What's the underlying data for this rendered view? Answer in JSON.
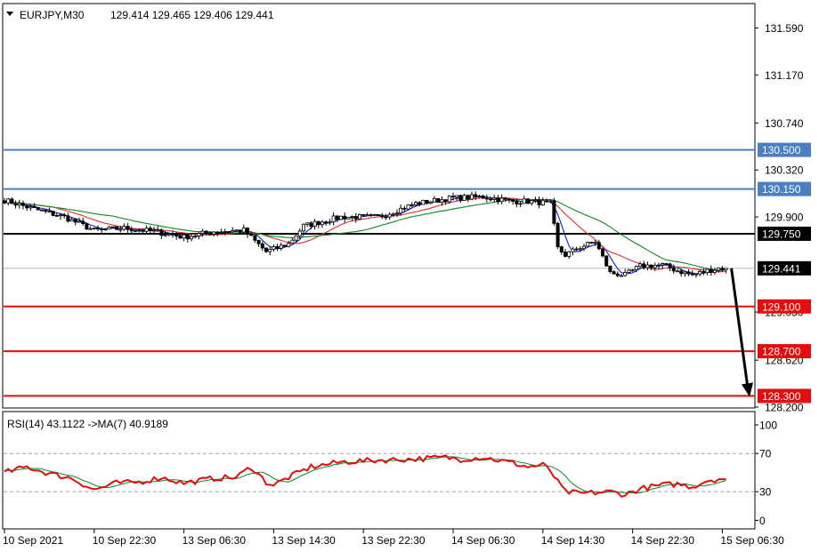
{
  "header": {
    "symbol_label": "EURJPY,M30",
    "ohlc": "129.414 129.465 129.406 129.441"
  },
  "rsi_header": "RSI(14) 43.1122  ->MA(7) 40.9189",
  "colors": {
    "background": "#ffffff",
    "frame": "#000000",
    "resistance": "#4a7fc1",
    "pivot": "#000000",
    "support": "#e30d0d",
    "candle": "#000000",
    "ma_fast": "#0c1bd6",
    "ma_mid": "#e03030",
    "ma_slow": "#0b8a22",
    "rsi": "#e30d0d",
    "rsi_ma": "#0b8a22",
    "current_price_line": "#b4b4b4",
    "arrow": "#000000"
  },
  "chart_data": [
    {
      "type": "candlestick",
      "symbol": "EURJPY",
      "timeframe": "M30",
      "ylim": [
        128.2,
        131.8
      ],
      "y_ticks": [
        "131.590",
        "131.170",
        "130.740",
        "130.320",
        "129.900",
        "129.050",
        "128.620",
        "128.200"
      ],
      "x_ticks": [
        "10 Sep 2021",
        "10 Sep 22:30",
        "13 Sep 06:30",
        "13 Sep 14:30",
        "13 Sep 22:30",
        "14 Sep 06:30",
        "14 Sep 14:30",
        "14 Sep 22:30",
        "15 Sep 06:30"
      ],
      "x_tick_positions": [
        0,
        24,
        48,
        72,
        96,
        120,
        144,
        168,
        192
      ],
      "bar_count": 194,
      "close_anchors": [
        [
          0,
          130.05
        ],
        [
          8,
          129.97
        ],
        [
          16,
          129.9
        ],
        [
          24,
          129.78
        ],
        [
          32,
          129.8
        ],
        [
          40,
          129.77
        ],
        [
          48,
          129.72
        ],
        [
          56,
          129.77
        ],
        [
          64,
          129.78
        ],
        [
          70,
          129.59
        ],
        [
          76,
          129.66
        ],
        [
          80,
          129.82
        ],
        [
          90,
          129.9
        ],
        [
          100,
          129.9
        ],
        [
          110,
          130.02
        ],
        [
          120,
          130.07
        ],
        [
          128,
          130.08
        ],
        [
          136,
          130.04
        ],
        [
          140,
          130.04
        ],
        [
          146,
          130.02
        ],
        [
          148,
          129.62
        ],
        [
          150,
          129.56
        ],
        [
          154,
          129.63
        ],
        [
          158,
          129.68
        ],
        [
          162,
          129.4
        ],
        [
          166,
          129.38
        ],
        [
          170,
          129.46
        ],
        [
          176,
          129.47
        ],
        [
          180,
          129.42
        ],
        [
          184,
          129.38
        ],
        [
          188,
          129.42
        ],
        [
          191,
          129.44
        ],
        [
          193,
          129.441
        ]
      ],
      "horizontal_levels": [
        {
          "label": "130.500",
          "value": 130.5,
          "kind": "resistance"
        },
        {
          "label": "130.150",
          "value": 130.15,
          "kind": "resistance"
        },
        {
          "label": "129.750",
          "value": 129.75,
          "kind": "pivot"
        },
        {
          "label": "129.441",
          "value": 129.441,
          "kind": "current"
        },
        {
          "label": "129.100",
          "value": 129.1,
          "kind": "support"
        },
        {
          "label": "128.700",
          "value": 128.7,
          "kind": "support"
        },
        {
          "label": "128.300",
          "value": 128.3,
          "kind": "support"
        }
      ],
      "current_price": 129.441,
      "arrow_target": 128.3,
      "moving_averages": [
        {
          "color": "ma_fast",
          "period": 5
        },
        {
          "color": "ma_mid",
          "period": 14
        },
        {
          "color": "ma_slow",
          "period": 30
        }
      ]
    },
    {
      "type": "line",
      "name": "RSI(14)",
      "ylim": [
        -8,
        113
      ],
      "y_ticks": [
        "100",
        "70",
        "30",
        "0"
      ],
      "dashed_levels": [
        70,
        30
      ],
      "rsi_value": 43.1122,
      "rsi_ma_value": 40.9189,
      "rsi_anchors": [
        [
          0,
          50
        ],
        [
          6,
          56
        ],
        [
          12,
          49
        ],
        [
          18,
          44
        ],
        [
          24,
          32
        ],
        [
          30,
          39
        ],
        [
          36,
          40
        ],
        [
          42,
          45
        ],
        [
          48,
          39
        ],
        [
          56,
          44
        ],
        [
          62,
          45
        ],
        [
          66,
          56
        ],
        [
          70,
          40
        ],
        [
          72,
          37
        ],
        [
          76,
          45
        ],
        [
          82,
          56
        ],
        [
          90,
          61
        ],
        [
          100,
          63
        ],
        [
          108,
          64
        ],
        [
          114,
          65
        ],
        [
          118,
          66
        ],
        [
          122,
          64
        ],
        [
          128,
          66
        ],
        [
          136,
          60
        ],
        [
          140,
          56
        ],
        [
          144,
          58
        ],
        [
          146,
          52
        ],
        [
          148,
          40
        ],
        [
          150,
          30
        ],
        [
          154,
          28
        ],
        [
          158,
          29
        ],
        [
          162,
          30
        ],
        [
          166,
          27
        ],
        [
          170,
          33
        ],
        [
          176,
          37
        ],
        [
          180,
          38
        ],
        [
          184,
          35
        ],
        [
          188,
          42
        ],
        [
          191,
          43.1
        ],
        [
          193,
          43.11
        ]
      ]
    }
  ]
}
